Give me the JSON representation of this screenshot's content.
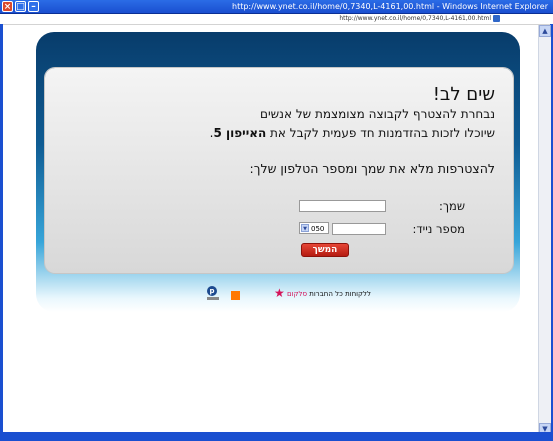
{
  "window": {
    "title": "http://www.ynet.co.il/home/0,7340,L-4161,00.html - Windows Internet Explorer",
    "url": "http://www.ynet.co.il/home/0,7340,L-4161,00.html"
  },
  "controls": {
    "close": "×",
    "max": "□",
    "min": "–",
    "scroll_up": "▲",
    "scroll_down": "▼",
    "select_arrow": "▼"
  },
  "promo": {
    "attention": "שים לב!",
    "line1": "נבחרת להצטרף לקבוצה מצומצמת של אנשים",
    "line2_start": "שיוכלו לזכות בהזדמנות חד פעמית לקבל את ",
    "line2_bold": "האייפון 5",
    "line2_end": ".",
    "instruction": "להצטרפות מלא את שמך ומספר הטלפון שלך:"
  },
  "form": {
    "name_label": "שמך:",
    "name_value": "",
    "phone_label": "מספר נייד:",
    "phone_value": "",
    "prefix_value": "050",
    "continue_label": "המשך"
  },
  "footer": {
    "customers_text": "ללקוחות כל החברות",
    "brand": "סלקום"
  },
  "colors": {
    "accent_red": "#c62a1c",
    "frame_blue": "#1a4fd0"
  }
}
